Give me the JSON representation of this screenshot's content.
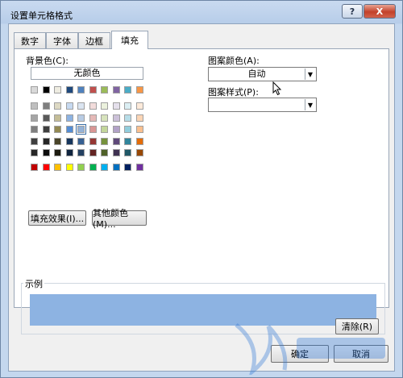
{
  "window": {
    "title": "设置单元格格式",
    "help_label": "?",
    "close_label": "X"
  },
  "tabs": [
    {
      "label": "数字",
      "active": false
    },
    {
      "label": "字体",
      "active": false
    },
    {
      "label": "边框",
      "active": false
    },
    {
      "label": "填充",
      "active": true
    }
  ],
  "fill": {
    "background_label": "背景色(C):",
    "no_color_label": "无颜色",
    "theme_row": [
      "#d9d9d9",
      "#000000",
      "#eeece1",
      "#1f497d",
      "#4f81bd",
      "#c0504d",
      "#9bbb59",
      "#8064a2",
      "#4bacc6",
      "#f79646"
    ],
    "shades": [
      [
        "#bfbfbf",
        "#7f7f7f",
        "#ddd9c3",
        "#c6d9f0",
        "#dbe5f1",
        "#f2dcdb",
        "#ebf1dd",
        "#e5e0ec",
        "#dbeef3",
        "#fdeada"
      ],
      [
        "#a5a5a5",
        "#595959",
        "#c4bd97",
        "#8db3e2",
        "#b8cce4",
        "#e5b9b7",
        "#d7e3bc",
        "#ccc1d9",
        "#b7dde8",
        "#fbd5b5"
      ],
      [
        "#7f7f7f",
        "#3f3f3f",
        "#938953",
        "#548dd4",
        "#95b3d7",
        "#d99694",
        "#c3d69b",
        "#b2a2c7",
        "#92cddc",
        "#fac08f"
      ],
      [
        "#3f3f3f",
        "#262626",
        "#494429",
        "#17365d",
        "#366092",
        "#953734",
        "#76923c",
        "#5f497a",
        "#31859b",
        "#e36c09"
      ],
      [
        "#262626",
        "#0c0c0c",
        "#1d1b10",
        "#0f243e",
        "#244061",
        "#632423",
        "#4f6128",
        "#3f3151",
        "#205867",
        "#974806"
      ]
    ],
    "standard_row": [
      "#c00000",
      "#ff0000",
      "#ffc000",
      "#ffff00",
      "#92d050",
      "#00b050",
      "#00b0f0",
      "#0070c0",
      "#002060",
      "#7030a0"
    ],
    "selected_color": "#95b3d7",
    "fill_effects_label": "填充效果(I)...",
    "more_colors_label": "其他颜色(M)...",
    "pattern_color_label": "图案颜色(A):",
    "pattern_color_value": "自动",
    "pattern_style_label": "图案样式(P):",
    "pattern_style_value": ""
  },
  "sample": {
    "label": "示例",
    "color": "#8db3e2"
  },
  "buttons": {
    "clear_label": "清除(R)",
    "ok_label": "确定",
    "cancel_label": "取消"
  }
}
